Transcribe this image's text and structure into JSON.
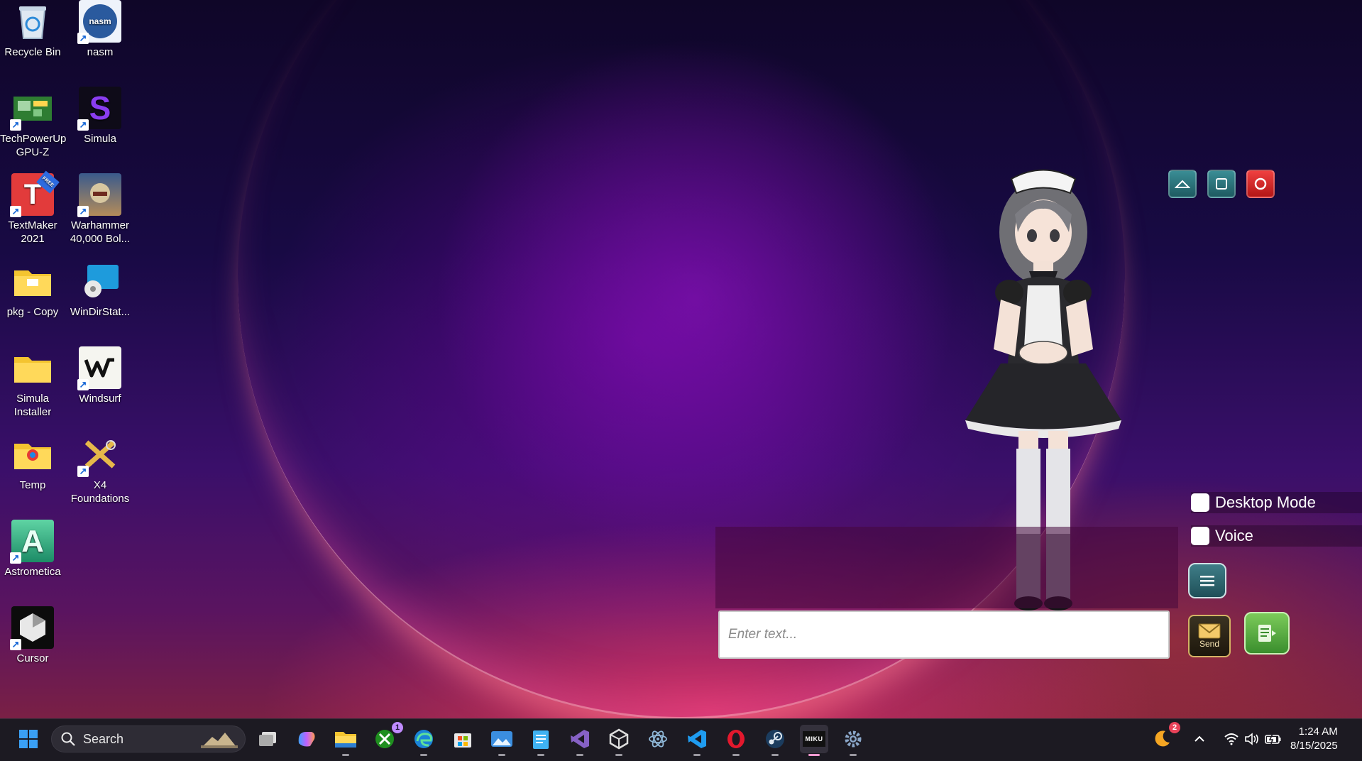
{
  "desktop": {
    "icons": [
      {
        "label": "Recycle Bin",
        "icon": "recycle-bin-icon"
      },
      {
        "label": "nasm",
        "icon": "nasm-icon"
      },
      {
        "label": "TechPowerUp GPU-Z",
        "icon": "gpu-z-icon"
      },
      {
        "label": "Simula",
        "icon": "simula-icon"
      },
      {
        "label": "TextMaker 2021",
        "icon": "textmaker-icon"
      },
      {
        "label": "Warhammer 40,000 Bol...",
        "icon": "warhammer-icon"
      },
      {
        "label": "pkg - Copy",
        "icon": "folder-icon"
      },
      {
        "label": "WinDirStat...",
        "icon": "windirstat-icon"
      },
      {
        "label": "Simula Installer",
        "icon": "folder-icon"
      },
      {
        "label": "Windsurf",
        "icon": "windsurf-icon"
      },
      {
        "label": "Temp",
        "icon": "folder-icon"
      },
      {
        "label": "X4 Foundations",
        "icon": "x4-icon"
      },
      {
        "label": "Astrometica",
        "icon": "astrometica-icon"
      },
      {
        "label": "Cursor",
        "icon": "cursor-app-icon"
      }
    ],
    "textmaker_badge": "FREE",
    "nasm_logo_text": "nasm",
    "simula_logo_text": "S",
    "textmaker_logo_text": "T",
    "astrometica_logo_text": "A"
  },
  "overlay_app": {
    "window_buttons": [
      "minimize",
      "maximize",
      "close"
    ],
    "options": [
      {
        "label": "Desktop Mode",
        "checked": false
      },
      {
        "label": "Voice",
        "checked": false
      }
    ],
    "chat_input_placeholder": "Enter text...",
    "send_label": "Send"
  },
  "taskbar": {
    "search_placeholder": "Search",
    "apps": [
      {
        "name": "start",
        "icon": "windows-start-icon"
      },
      {
        "name": "task-view",
        "icon": "task-view-icon"
      },
      {
        "name": "copilot",
        "icon": "copilot-icon"
      },
      {
        "name": "file-explorer",
        "icon": "folder-icon"
      },
      {
        "name": "xbox",
        "icon": "xbox-icon",
        "badge": "1"
      },
      {
        "name": "edge",
        "icon": "edge-icon"
      },
      {
        "name": "microsoft-store",
        "icon": "store-icon"
      },
      {
        "name": "photos",
        "icon": "photos-icon"
      },
      {
        "name": "notepad",
        "icon": "notepad-icon"
      },
      {
        "name": "visual-studio",
        "icon": "visual-studio-icon"
      },
      {
        "name": "unity",
        "icon": "unity-icon"
      },
      {
        "name": "electron",
        "icon": "electron-icon"
      },
      {
        "name": "vscode",
        "icon": "vscode-icon"
      },
      {
        "name": "opera",
        "icon": "opera-icon"
      },
      {
        "name": "steam",
        "icon": "steam-icon"
      },
      {
        "name": "miku",
        "icon": "miku-icon",
        "label": "MIKU"
      },
      {
        "name": "settings",
        "icon": "gear-icon"
      }
    ],
    "weather_badge": "2",
    "time": "1:24 AM",
    "date": "8/15/2025"
  }
}
